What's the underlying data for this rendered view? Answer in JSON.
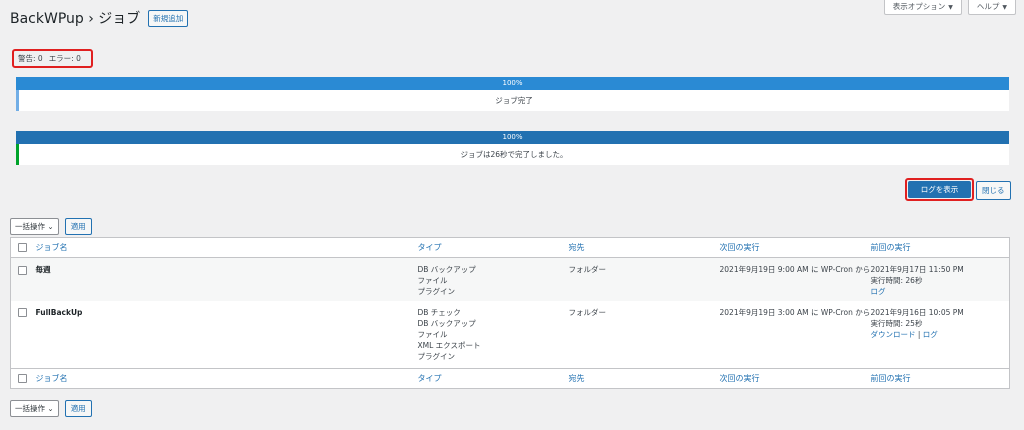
{
  "header": {
    "title": "BackWPup › ジョブ",
    "add_new": "新規追加",
    "screen_options": "表示オプション",
    "help": "ヘルプ",
    "caret": "▼"
  },
  "status": {
    "warnings": "警告: 0",
    "errors": "エラー: 0"
  },
  "progress": [
    {
      "percent_label": "100%",
      "message": "ジョブ完了"
    },
    {
      "percent_label": "100%",
      "message": "ジョブは26秒で完了しました。"
    }
  ],
  "actions": {
    "show_log": "ログを表示",
    "close": "閉じる"
  },
  "bulk": {
    "select_label": "一括操作",
    "apply": "適用"
  },
  "table": {
    "columns": [
      "ジョブ名",
      "タイプ",
      "宛先",
      "次回の実行",
      "前回の実行"
    ],
    "rows": [
      {
        "name": "毎週",
        "types": [
          "DB バックアップ",
          "ファイル",
          "プラグイン"
        ],
        "destination": "フォルダー",
        "next_run": "2021年9月19日 9:00 AM に WP-Cron から",
        "last_run": "2021年9月17日 11:50 PM",
        "runtime": "実行時間: 26秒",
        "links": [
          "ログ"
        ]
      },
      {
        "name": "FullBackUp",
        "types": [
          "DB チェック",
          "DB バックアップ",
          "ファイル",
          "XML エクスポート",
          "プラグイン"
        ],
        "destination": "フォルダー",
        "next_run": "2021年9月19日 3:00 AM に WP-Cron から",
        "last_run": "2021年9月16日 10:05 PM",
        "runtime": "実行時間: 25秒",
        "links": [
          "ダウンロード",
          "ログ"
        ],
        "link_separator": " | "
      }
    ]
  },
  "colors": {
    "primary": "#2271b1",
    "progress_light": "#2a8ad4",
    "success": "#00a32a",
    "highlight": "#e02020"
  }
}
